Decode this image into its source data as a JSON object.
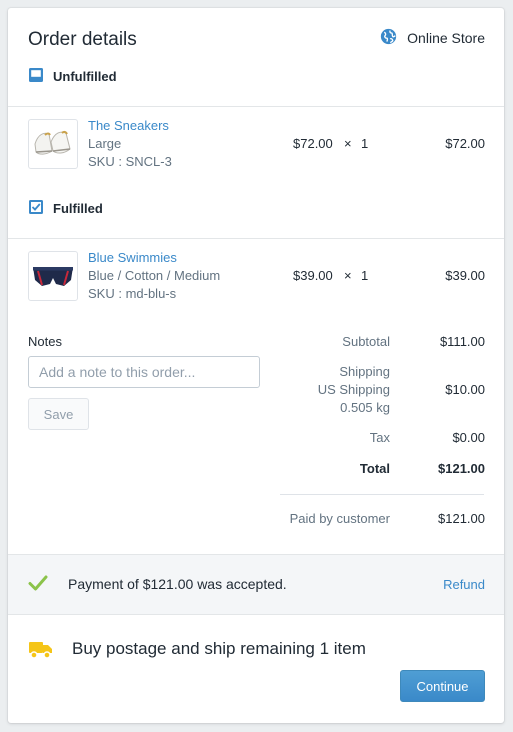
{
  "header": {
    "title": "Order details",
    "channel": "Online Store",
    "channel_icon": "globe-icon"
  },
  "colors": {
    "link": "#3a89c9",
    "primary_button": "#3a89c9",
    "success_check": "#8bc34a",
    "shipping_truck": "#f5c518"
  },
  "unfulfilled": {
    "label": "Unfulfilled",
    "icon": "inbox-icon",
    "items": [
      {
        "name": "The Sneakers",
        "variant": "Large",
        "sku": "SKU : SNCL-3",
        "price": "$72.00",
        "times": "×",
        "quantity": "1",
        "line_total": "$72.00"
      }
    ]
  },
  "fulfilled": {
    "label": "Fulfilled",
    "icon": "checkbox-checked-icon",
    "items": [
      {
        "name": "Blue Swimmies",
        "variant": "Blue / Cotton / Medium",
        "sku": "SKU : md-blu-s",
        "price": "$39.00",
        "times": "×",
        "quantity": "1",
        "line_total": "$39.00"
      }
    ]
  },
  "notes": {
    "label": "Notes",
    "placeholder": "Add a note to this order...",
    "value": "",
    "save_label": "Save"
  },
  "summary": {
    "subtotal_label": "Subtotal",
    "subtotal_value": "$111.00",
    "shipping_label": "Shipping",
    "shipping_method": "US Shipping",
    "shipping_weight": "0.505 kg",
    "shipping_value": "$10.00",
    "tax_label": "Tax",
    "tax_value": "$0.00",
    "total_label": "Total",
    "total_value": "$121.00",
    "paid_label": "Paid by customer",
    "paid_value": "$121.00"
  },
  "payment": {
    "message": "Payment of $121.00 was accepted.",
    "refund_label": "Refund",
    "icon": "checkmark-icon"
  },
  "shipping_action": {
    "message": "Buy postage and ship remaining 1 item",
    "icon": "truck-icon",
    "continue_label": "Continue"
  }
}
